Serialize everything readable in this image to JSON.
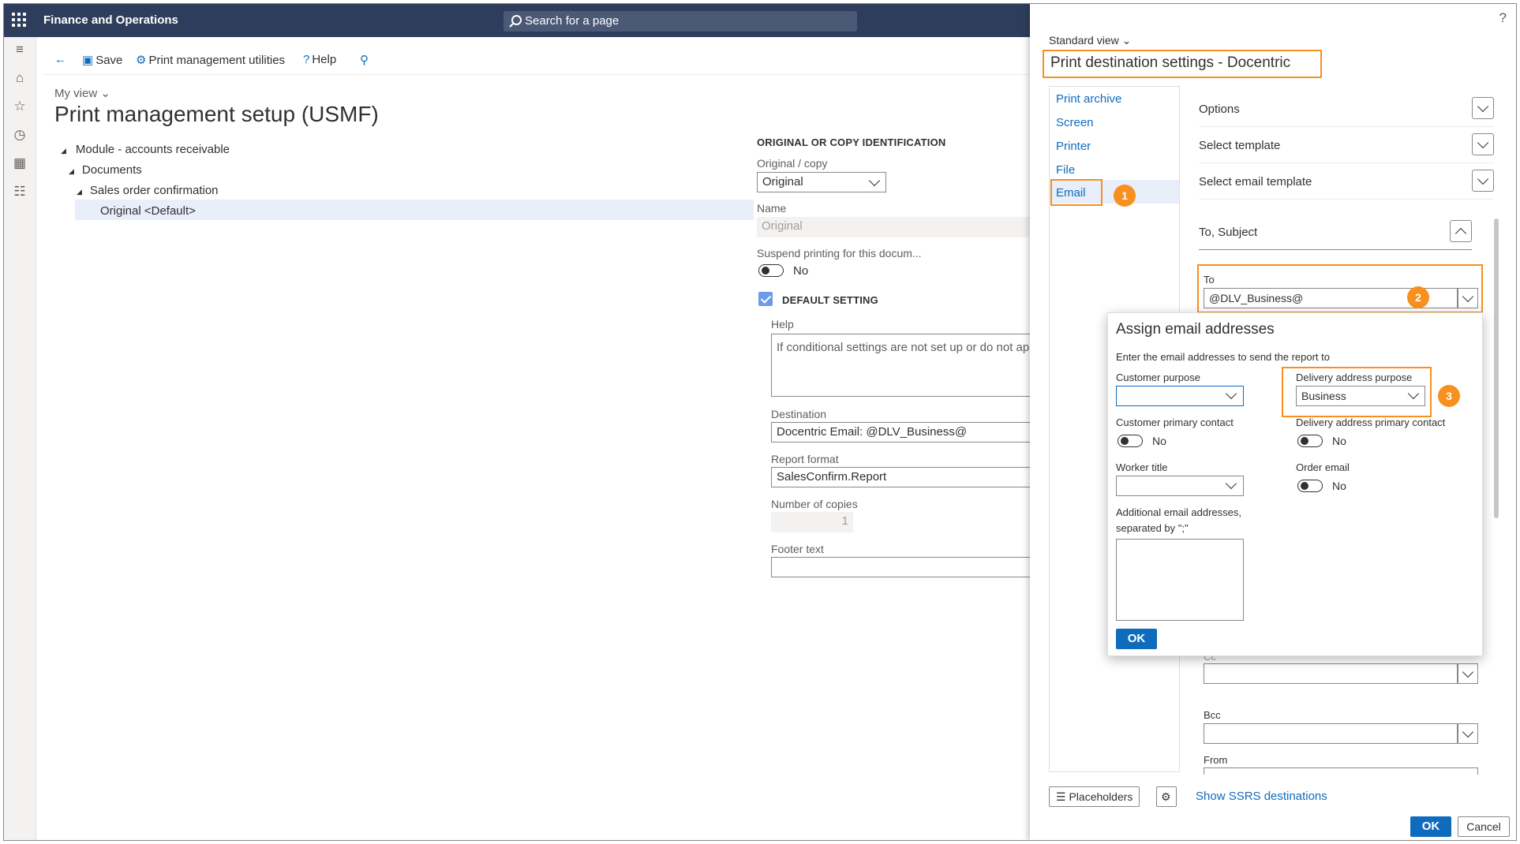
{
  "app": {
    "title": "Finance and Operations",
    "search_placeholder": "Search for a page"
  },
  "actionbar": {
    "save": "Save",
    "print_utilities": "Print management utilities",
    "help": "Help"
  },
  "page": {
    "my_view": "My view",
    "title": "Print management setup (USMF)"
  },
  "tree": {
    "module": "Module - accounts receivable",
    "documents": "Documents",
    "sales_order": "Sales order confirmation",
    "original_default": "Original <Default>"
  },
  "form": {
    "section_title": "ORIGINAL OR COPY IDENTIFICATION",
    "original_copy_label": "Original / copy",
    "original_copy_value": "Original",
    "name_label": "Name",
    "name_value": "Original",
    "suspend_label": "Suspend printing for this docum...",
    "suspend_value": "No",
    "default_setting": "DEFAULT SETTING",
    "help_label": "Help",
    "help_value": "If conditional settings are not set up or do not ap",
    "destination_label": "Destination",
    "destination_value": "Docentric Email: @DLV_Business@",
    "report_format_label": "Report format",
    "report_format_value": "SalesConfirm.Report",
    "copies_label": "Number of copies",
    "copies_value": "1",
    "footer_label": "Footer text"
  },
  "panel": {
    "help": "?",
    "standard_view": "Standard view",
    "title": "Print destination settings - Docentric",
    "nav": [
      "Print archive",
      "Screen",
      "Printer",
      "File",
      "Email"
    ],
    "sections": {
      "options": "Options",
      "select_template": "Select template",
      "select_email_template": "Select email template",
      "to_subject": "To, Subject"
    },
    "to_label": "To",
    "to_value": "@DLV_Business@",
    "cc_label": "Cc",
    "bcc_label": "Bcc",
    "from_label": "From",
    "placeholders": "Placeholders",
    "show_ssrs": "Show SSRS destinations",
    "ok": "OK",
    "cancel": "Cancel"
  },
  "popup": {
    "title": "Assign email addresses",
    "desc": "Enter the email addresses to send the report to",
    "customer_purpose_label": "Customer purpose",
    "customer_purpose_value": "",
    "delivery_purpose_label": "Delivery address purpose",
    "delivery_purpose_value": "Business",
    "customer_contact_label": "Customer primary contact",
    "customer_contact_value": "No",
    "delivery_contact_label": "Delivery address primary contact",
    "delivery_contact_value": "No",
    "worker_title_label": "Worker title",
    "order_email_label": "Order email",
    "order_email_value": "No",
    "additional_label_1": "Additional email addresses,",
    "additional_label_2": "separated by \";\"",
    "ok": "OK"
  },
  "badges": [
    "1",
    "2",
    "3"
  ],
  "colors": {
    "nav_bar": "#2f3d5c",
    "accent": "#0f6cbd",
    "highlight": "#f7901e",
    "selection": "#e8eefa"
  }
}
